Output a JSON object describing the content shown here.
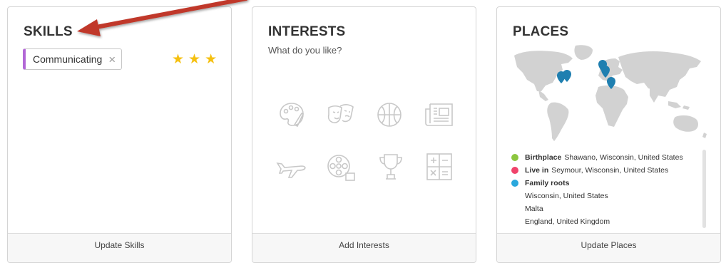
{
  "skills": {
    "title": "SKILLS",
    "chip": {
      "label": "Communicating",
      "remove_icon": "close-icon",
      "accent": "#b267d6"
    },
    "rating": {
      "value": 3,
      "max": 3,
      "color": "#f5c010"
    },
    "footer_label": "Update Skills"
  },
  "interests": {
    "title": "INTERESTS",
    "subtitle": "What do you like?",
    "icons": [
      "palette-icon",
      "theater-masks-icon",
      "basketball-icon",
      "newspaper-icon",
      "airplane-icon",
      "film-reel-icon",
      "trophy-icon",
      "calculator-icon"
    ],
    "footer_label": "Add Interests"
  },
  "places": {
    "title": "PLACES",
    "legend": [
      {
        "label": "Birthplace",
        "value": "Shawano, Wisconsin, United States",
        "color": "#8cc63f"
      },
      {
        "label": "Live in",
        "value": "Seymour, Wisconsin, United States",
        "color": "#f0436b"
      },
      {
        "label": "Family roots",
        "value": "",
        "color": "#2aa8dd"
      }
    ],
    "family_roots": [
      "Wisconsin, United States",
      "Malta",
      "England, United Kingdom"
    ],
    "footer_label": "Update Places",
    "pin_color": "#1f7fb0"
  },
  "annotation": {
    "arrow_color": "#c0392b"
  }
}
